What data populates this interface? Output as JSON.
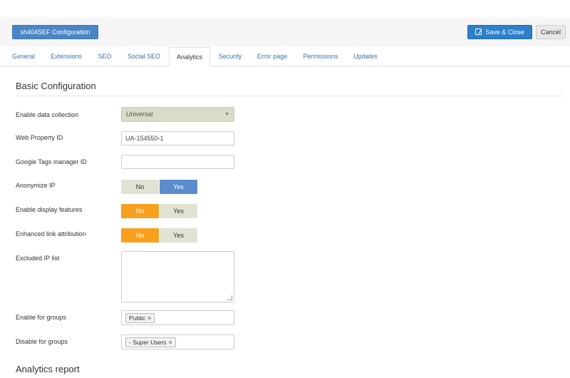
{
  "toolbar": {
    "title": "sh404SEF Configuration",
    "save_label": "Save & Close",
    "cancel_label": "Cancel"
  },
  "tabs": [
    {
      "label": "General"
    },
    {
      "label": "Extensions"
    },
    {
      "label": "SEO"
    },
    {
      "label": "Social SEO"
    },
    {
      "label": "Analytics",
      "active": true
    },
    {
      "label": "Security"
    },
    {
      "label": "Error page"
    },
    {
      "label": "Permissions"
    },
    {
      "label": "Updates"
    }
  ],
  "basic": {
    "title": "Basic Configuration",
    "data_collection": {
      "label": "Enable data collection",
      "value": "Universal"
    },
    "web_property": {
      "label": "Web Property ID",
      "value": "UA-154550-1"
    },
    "tags_manager": {
      "label": "Google Tags manager ID",
      "value": ""
    },
    "anonymize": {
      "label": "Anonymize IP",
      "no": "No",
      "yes": "Yes",
      "selected": "Yes"
    },
    "display_features": {
      "label": "Enable display features",
      "no": "No",
      "yes": "Yes",
      "selected": "No"
    },
    "link_attribution": {
      "label": "Enhanced link attribution",
      "no": "No",
      "yes": "Yes",
      "selected": "No"
    },
    "excluded_ip": {
      "label": "Excluded IP list",
      "value": ""
    },
    "enable_groups": {
      "label": "Enable for groups",
      "chip": "Public"
    },
    "disable_groups": {
      "label": "Disable for groups",
      "chip": "- Super Users"
    }
  },
  "report": {
    "title": "Analytics report"
  },
  "colors": {
    "primary": "#2d7fc9",
    "toggle_on_yes": "#5a8ccd",
    "toggle_on_no": "#f8a01e",
    "toggle_off": "#e0e3d2"
  }
}
